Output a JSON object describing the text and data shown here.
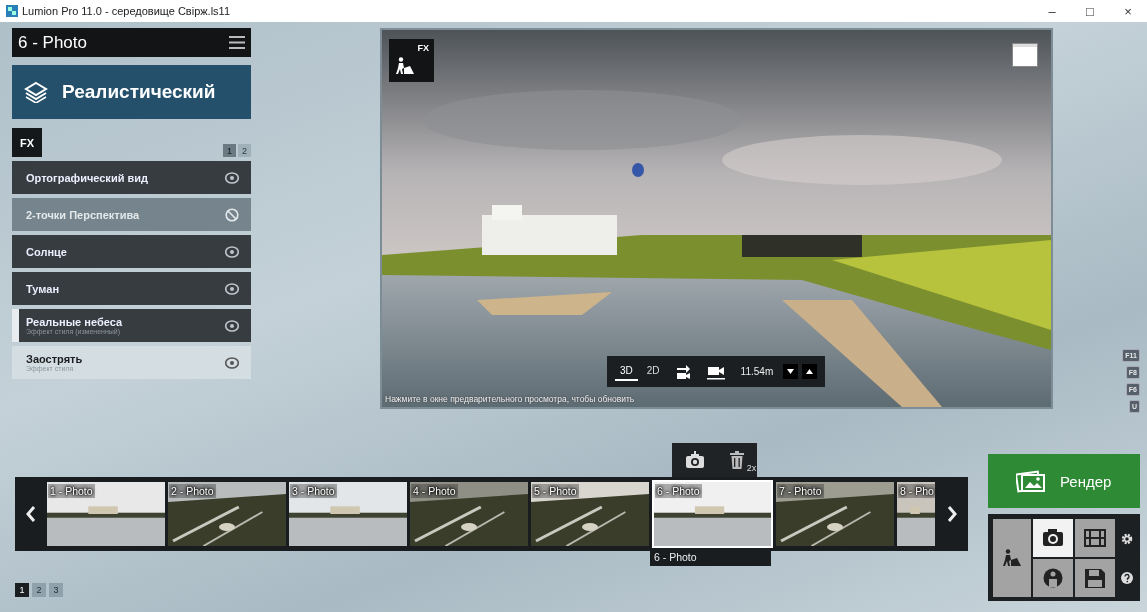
{
  "window": {
    "title": "Lumion Pro 11.0  - середовище Свірж.ls11",
    "controls": [
      "–",
      "□",
      "×"
    ]
  },
  "panel": {
    "title": "6 - Photo",
    "style": "Реалистический",
    "fx_label": "FX",
    "pages": [
      {
        "label": "1",
        "selected": true
      },
      {
        "label": "2",
        "selected": false
      }
    ]
  },
  "effects": [
    {
      "name": "Ортографический вид",
      "enabled": true,
      "selected": false,
      "hovered": false
    },
    {
      "name": "2-точки Перспектива",
      "enabled": false,
      "selected": false,
      "hovered": false
    },
    {
      "name": "Солнце",
      "enabled": true,
      "selected": false,
      "hovered": false
    },
    {
      "name": "Туман",
      "enabled": true,
      "selected": false,
      "hovered": false
    },
    {
      "name": "Реальные небеса",
      "subtitle": "Эффект стиля (измененный)",
      "enabled": true,
      "selected": true,
      "hovered": false
    },
    {
      "name": "Заострять",
      "subtitle": "Эффект стиля",
      "enabled": true,
      "selected": false,
      "hovered": true
    }
  ],
  "preview": {
    "fx_badge": "FX",
    "modes": [
      {
        "label": "3D",
        "selected": true
      },
      {
        "label": "2D",
        "selected": false
      }
    ],
    "distance": "11.54m",
    "hint": "Нажмите в окне предварительного просмотра, чтобы обновить"
  },
  "shortcut_keys": [
    "F11",
    "F8",
    "F6",
    "U"
  ],
  "photo_actions": {
    "delete_badge": "2x"
  },
  "thumbnails": [
    {
      "label": "1 - Photo",
      "selected": false
    },
    {
      "label": "2 - Photo",
      "selected": false
    },
    {
      "label": "3 - Photo",
      "selected": false
    },
    {
      "label": "4 - Photo",
      "selected": false
    },
    {
      "label": "5 - Photo",
      "selected": false
    },
    {
      "label": "6 - Photo",
      "selected": true
    },
    {
      "label": "7 - Photo",
      "selected": false
    },
    {
      "label": "8 - Pho",
      "selected": false
    }
  ],
  "selected_caption": "6 - Photo",
  "pages": [
    {
      "label": "1",
      "selected": true
    },
    {
      "label": "2",
      "selected": false
    },
    {
      "label": "3",
      "selected": false
    }
  ],
  "render_button": "Рендер",
  "modes": [
    {
      "kind": "camera",
      "selected": true
    },
    {
      "kind": "movie",
      "selected": false
    },
    {
      "kind": "panorama",
      "selected": false
    },
    {
      "kind": "save",
      "selected": false
    }
  ]
}
